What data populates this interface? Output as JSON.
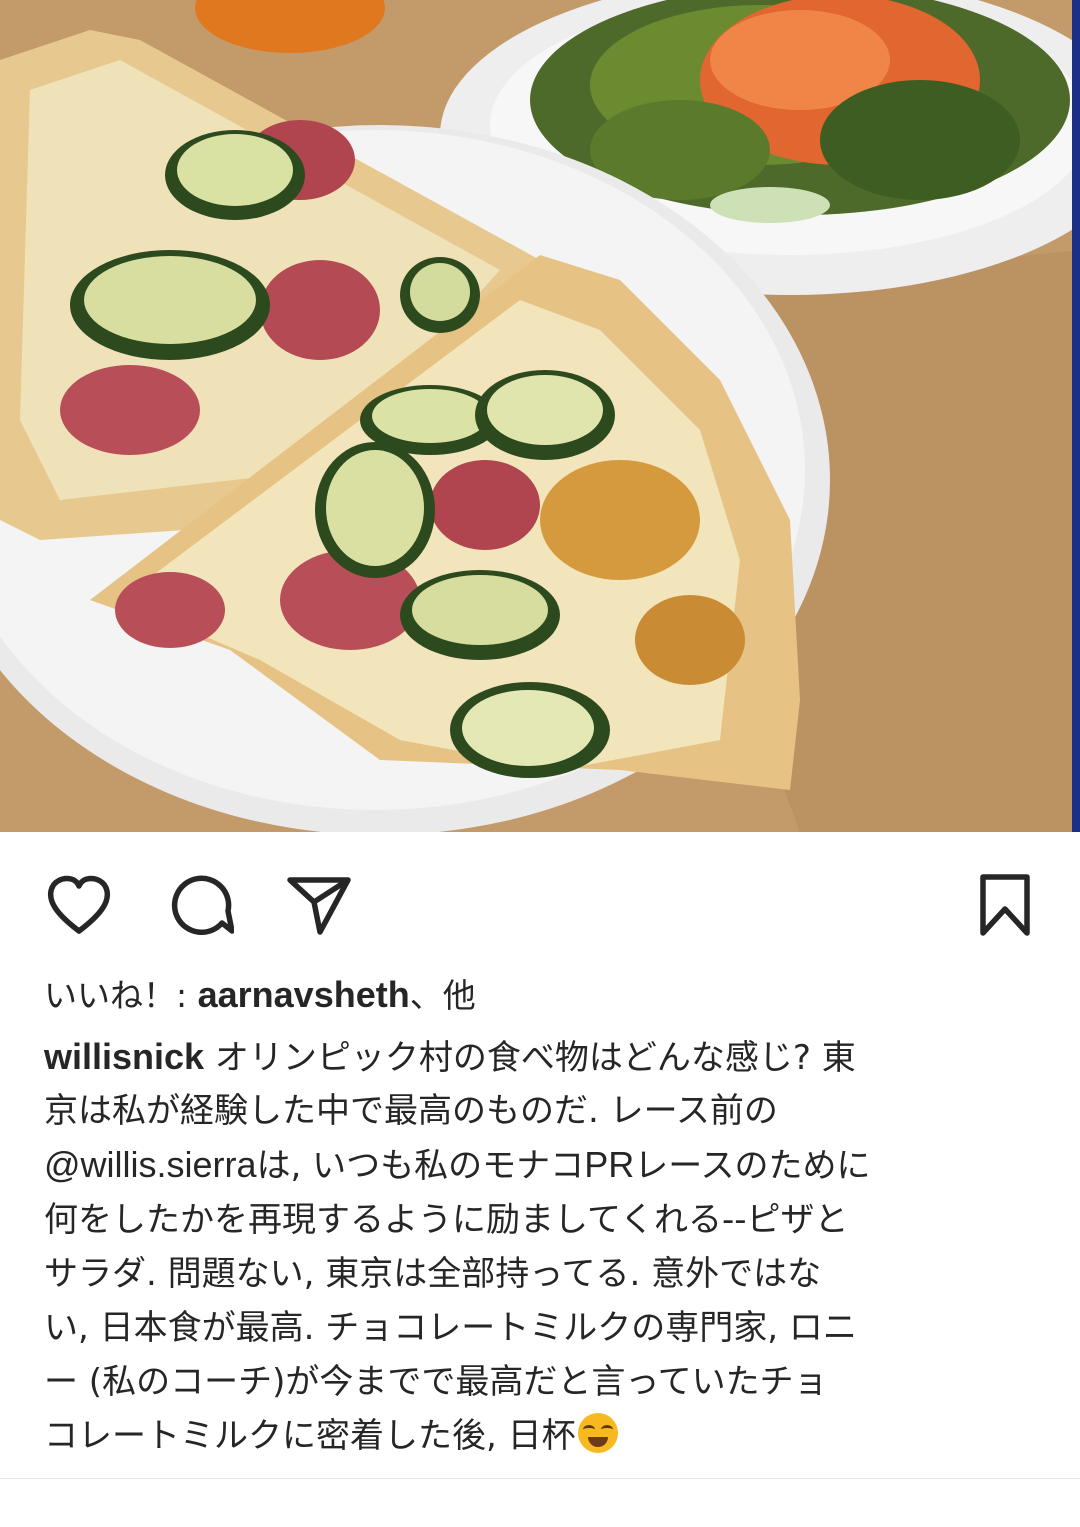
{
  "post": {
    "photo_alt": "",
    "liked_by_prefix": "いいね！: ",
    "liked_by_user": "aarnavsheth",
    "liked_by_suffix": "、他",
    "author": "willisnick",
    "caption_lines": [
      [
        "オリンピック村の食べ物はどんな感じ? 東"
      ],
      [
        "京は私が経験した中で最高のものだ. レース前の"
      ],
      [
        "@willis.sierra",
        "は, いつも私のモナコ",
        "PR",
        "レースのために"
      ],
      [
        "何をしたかを再現するように励ましてくれる--ピザと"
      ],
      [
        "サラダ. 問題ない, 東京は全部持ってる. 意外ではな"
      ],
      [
        "い, 日本食が最高. チョコレートミルクの専門家, ロニ"
      ],
      [
        "ー (私のコーチ)が今までで最高だと言っていたチョ"
      ],
      [
        "コレートミルクに密着した後, 日杯"
      ]
    ],
    "emoji": "rolling-on-floor-laughing"
  },
  "actions": {
    "like_icon": "heart-icon",
    "comment_icon": "comment-icon",
    "share_icon": "send-icon",
    "save_icon": "bookmark-icon"
  },
  "colors": {
    "text": "#262626",
    "tray": "#c2996a",
    "table_edge": "#1b2f86"
  }
}
